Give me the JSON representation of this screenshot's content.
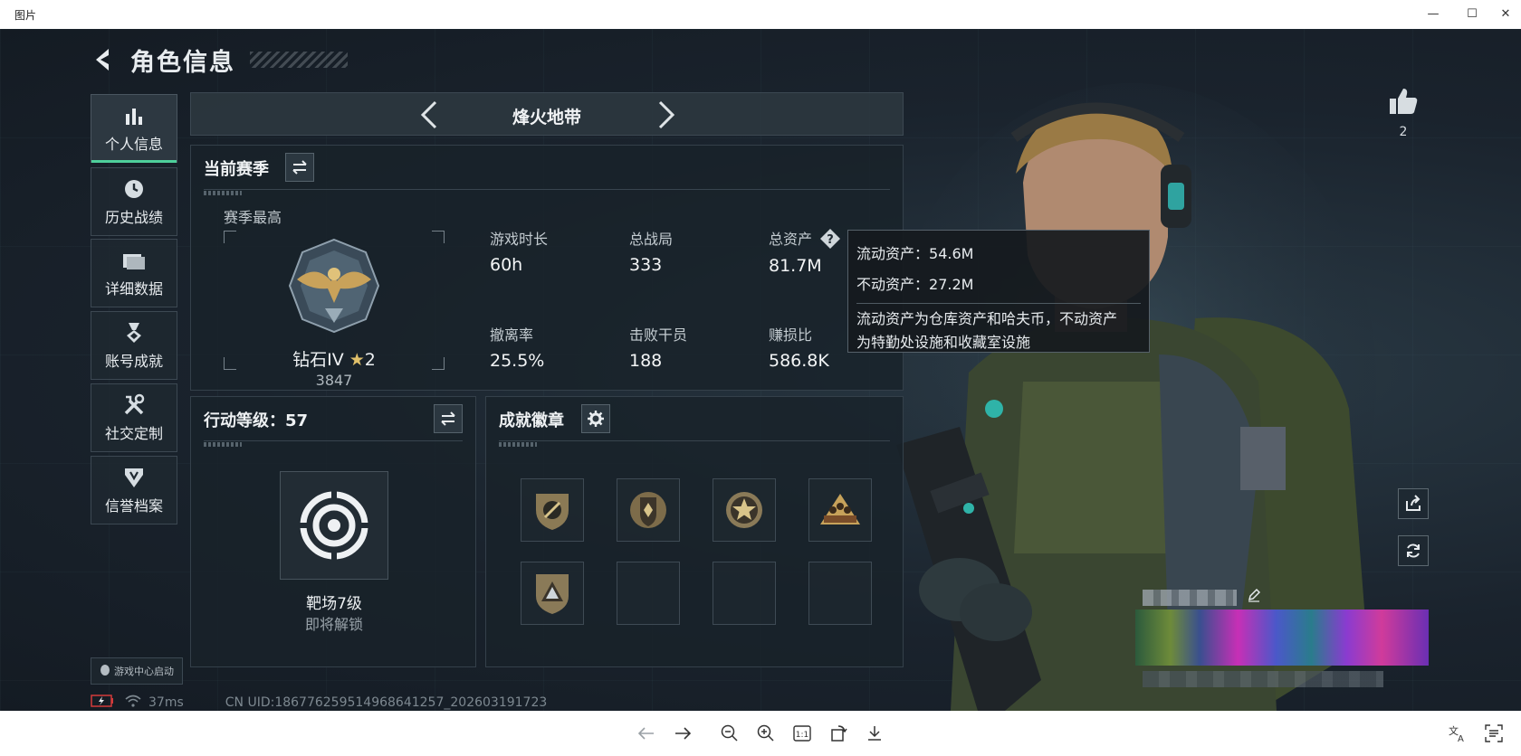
{
  "window": {
    "title": "图片"
  },
  "page": {
    "title": "角色信息"
  },
  "sidebar": {
    "items": [
      {
        "label": "个人信息"
      },
      {
        "label": "历史战绩"
      },
      {
        "label": "详细数据"
      },
      {
        "label": "账号成就"
      },
      {
        "label": "社交定制"
      },
      {
        "label": "信誉档案"
      }
    ],
    "launch_chip": "游戏中心启动"
  },
  "mode_bar": {
    "name": "烽火地带"
  },
  "season_panel": {
    "title": "当前赛季",
    "best_label": "赛季最高",
    "rank_name": "钻石IV",
    "rank_stars": "2",
    "rank_score": "3847",
    "stats": [
      {
        "label": "游戏时长",
        "value": "60h"
      },
      {
        "label": "总战局",
        "value": "333"
      },
      {
        "label": "总资产",
        "value": "81.7M"
      },
      {
        "label": "撤离率",
        "value": "25.5%"
      },
      {
        "label": "击败干员",
        "value": "188"
      },
      {
        "label": "赚损比",
        "value": "586.8K"
      }
    ]
  },
  "tooltip": {
    "liquid_label": "流动资产：",
    "liquid_value": "54.6M",
    "fixed_label": "不动资产：",
    "fixed_value": "27.2M",
    "desc_line1": "流动资产为仓库资产和哈夫币，不动资产",
    "desc_line2": "为特勤处设施和收藏室设施"
  },
  "action_panel": {
    "title": "行动等级：57",
    "item_name": "靶场7级",
    "item_status": "即将解锁"
  },
  "achievement_panel": {
    "title": "成就徽章",
    "badges": [
      "badge-1",
      "badge-2",
      "badge-3",
      "badge-4",
      "badge-5",
      "",
      "",
      ""
    ]
  },
  "likes": {
    "count": "2"
  },
  "status_bar": {
    "ping": "37ms",
    "uid": "CN UID:18677625951496864​1257_202603191723"
  },
  "colors": {
    "accent": "#4ecf9b",
    "background": "#1c2530"
  }
}
